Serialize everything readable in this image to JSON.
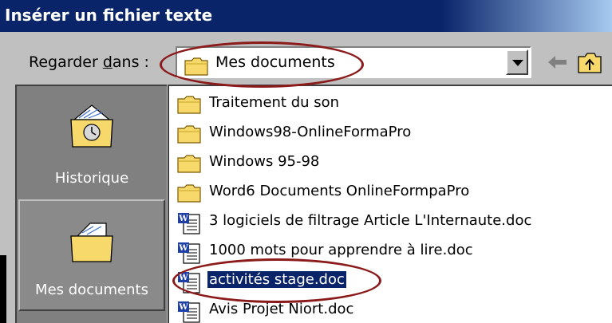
{
  "window": {
    "title": "Insérer un fichier texte"
  },
  "lookin": {
    "label_pre": "Regarder ",
    "label_underlined": "d",
    "label_post": "ans :",
    "value": "Mes documents"
  },
  "places": [
    {
      "label": "Historique",
      "icon": "history-folder-icon"
    },
    {
      "label": "Mes documents",
      "icon": "my-documents-folder-icon"
    }
  ],
  "files": [
    {
      "name": "Traitement du son",
      "type": "folder"
    },
    {
      "name": "Windows98-OnlineFormaPro",
      "type": "folder"
    },
    {
      "name": "Windows 95-98",
      "type": "folder"
    },
    {
      "name": "Word6 Documents OnlineFormpaPro",
      "type": "folder"
    },
    {
      "name": "3 logiciels de filtrage Article L'Internaute.doc",
      "type": "doc"
    },
    {
      "name": "1000 mots pour apprendre à lire.doc",
      "type": "doc"
    },
    {
      "name": "activités stage.doc",
      "type": "doc",
      "selected": true
    },
    {
      "name": "Avis Projet Niort.doc",
      "type": "doc"
    }
  ],
  "colors": {
    "titlebar": "#0a246a",
    "selection": "#0a246a",
    "annotation": "#8b1a1a",
    "folder": "#f4d35e"
  }
}
